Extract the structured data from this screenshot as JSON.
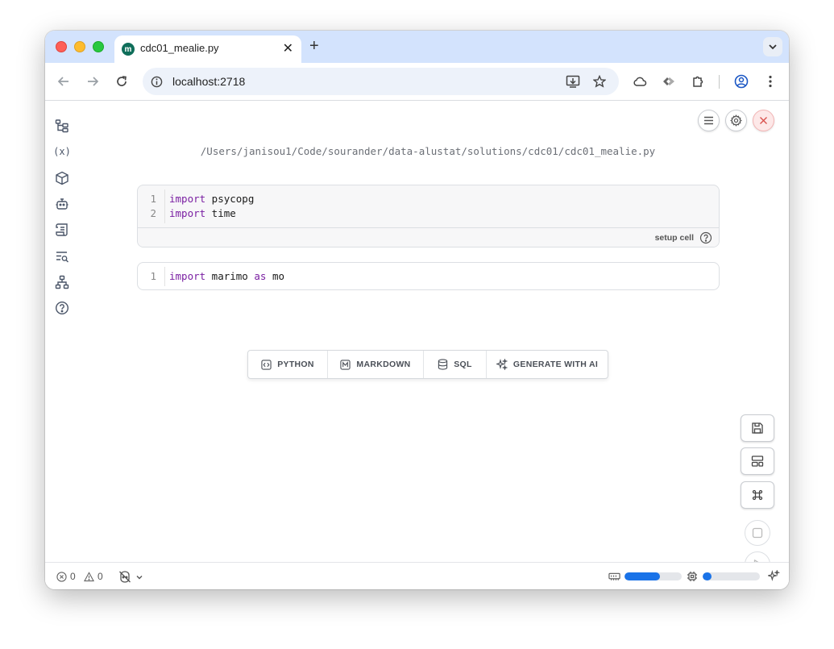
{
  "browser": {
    "tab_title": "cdc01_mealie.py",
    "tab_favicon": "m",
    "url": "localhost:2718"
  },
  "notebook": {
    "file_path": "/Users/janisou1/Code/sourander/data-alustat/solutions/cdc01/cdc01_mealie.py",
    "setup_cell": {
      "label": "setup cell",
      "lines": [
        {
          "num": "1",
          "kw": "import",
          "rest": " psycopg"
        },
        {
          "num": "2",
          "kw": "import",
          "rest": " time"
        }
      ]
    },
    "cell2": {
      "lines": [
        {
          "num": "1",
          "kw1": "import",
          "mid": " marimo ",
          "kw2": "as",
          "rest": " mo"
        }
      ]
    },
    "add_buttons": [
      {
        "label": "PYTHON",
        "icon": "code-icon"
      },
      {
        "label": "MARKDOWN",
        "icon": "markdown-icon"
      },
      {
        "label": "SQL",
        "icon": "database-icon"
      },
      {
        "label": "GENERATE WITH AI",
        "icon": "sparkles-icon"
      }
    ]
  },
  "footer": {
    "errors": "0",
    "warnings": "0",
    "memory_fraction": 0.62,
    "cpu_fraction": 0.15
  },
  "colors": {
    "tabstrip": "#d3e3fd",
    "keyword": "#7a1fa2",
    "accent": "#1a73e8"
  }
}
